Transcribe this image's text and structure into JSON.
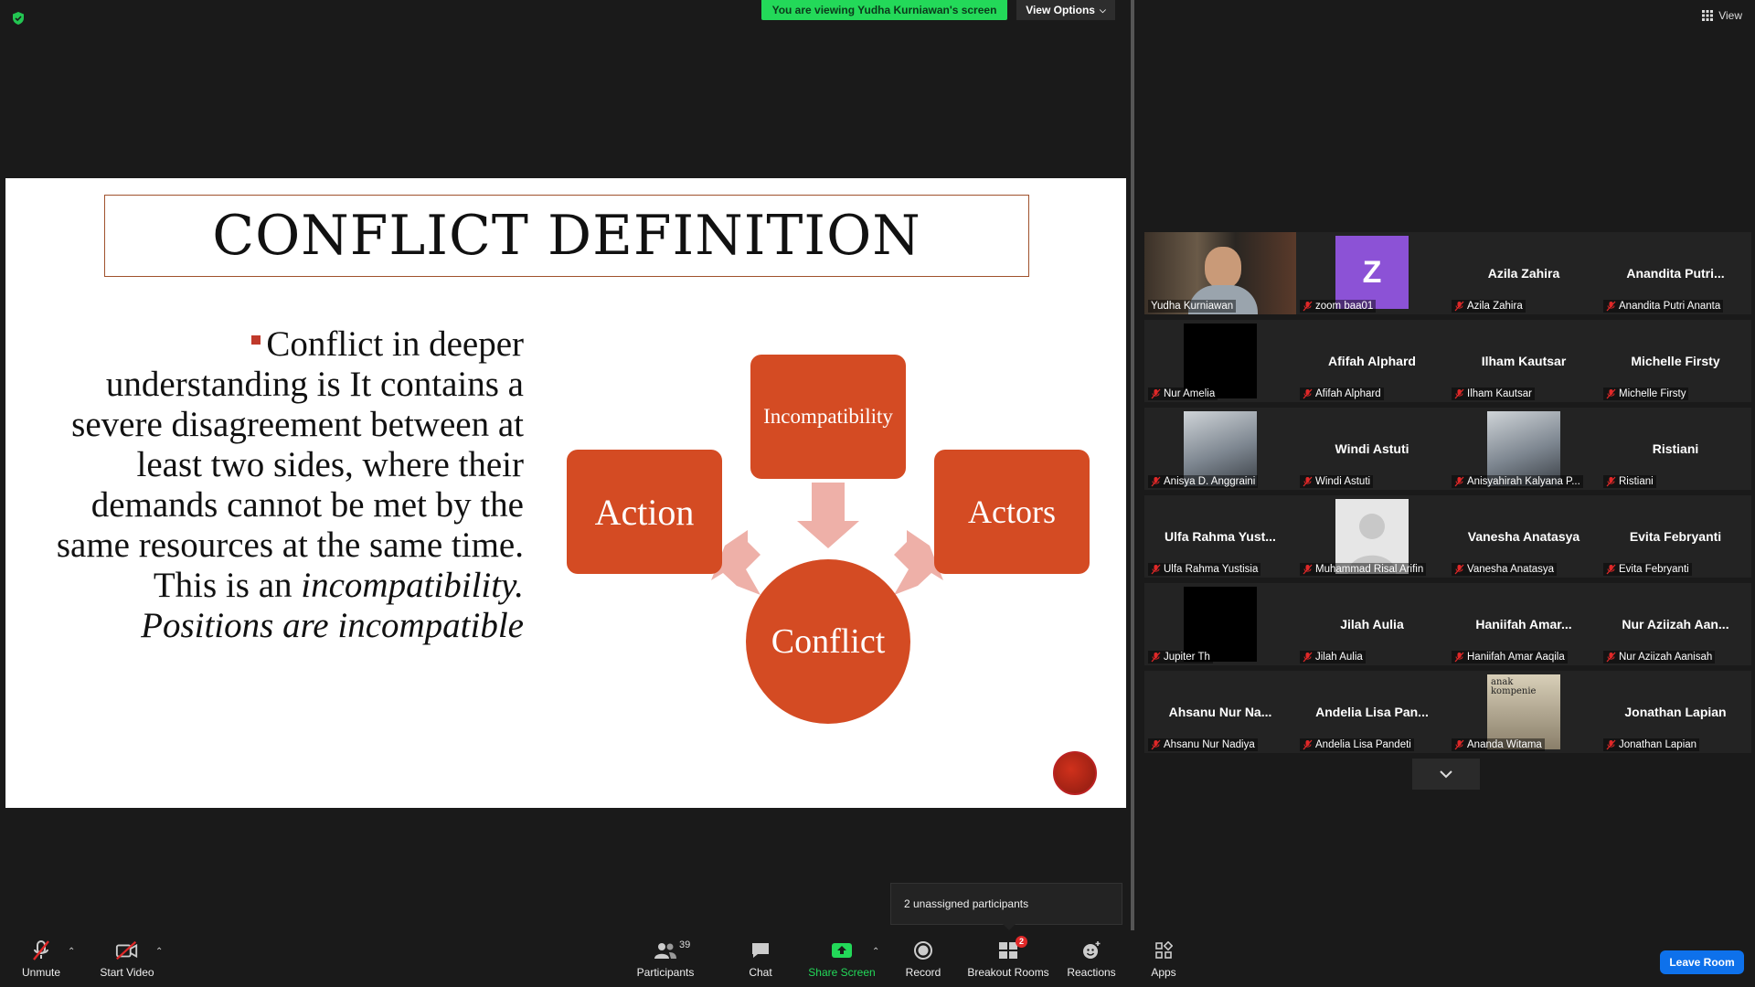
{
  "top": {
    "viewing_banner": "You are viewing Yudha Kurniawan's screen",
    "view_options": "View Options",
    "view_button": "View"
  },
  "slide": {
    "title": "CONFLICT DEFINITION",
    "body_plain": "Conflict in deeper understanding is It contains a severe disagreement between at least two sides, where their demands cannot be met by the same resources at the same time. This is an",
    "body_italic_1": "incompatibility.",
    "body_italic_2": "Positions are incompatible",
    "diagram": {
      "top_box": "Incompatibility",
      "left_box": "Action",
      "right_box": "Actors",
      "center": "Conflict"
    },
    "accent_color": "#d44b23"
  },
  "gallery": {
    "tiles": [
      {
        "name": "",
        "label": "Yudha Kurniawan",
        "type": "video",
        "active": true,
        "muted": false
      },
      {
        "name": "Z",
        "label": "zoom baa01",
        "type": "avatar",
        "muted": true
      },
      {
        "name": "Azila Zahira",
        "label": "Azila Zahira",
        "type": "name",
        "muted": true
      },
      {
        "name": "Anandita  Putri...",
        "label": "Anandita Putri Ananta",
        "type": "name",
        "muted": true
      },
      {
        "name": "",
        "label": "Nur Amelia",
        "type": "black",
        "muted": true
      },
      {
        "name": "Afifah Alphard",
        "label": "Afifah Alphard",
        "type": "name",
        "muted": true
      },
      {
        "name": "Ilham Kautsar",
        "label": "Ilham Kautsar",
        "type": "name",
        "muted": true
      },
      {
        "name": "Michelle Firsty",
        "label": "Michelle Firsty",
        "type": "name",
        "muted": true
      },
      {
        "name": "",
        "label": "Anisya D. Anggraini",
        "type": "photo",
        "muted": true
      },
      {
        "name": "Windi Astuti",
        "label": "Windi Astuti",
        "type": "name",
        "muted": true
      },
      {
        "name": "",
        "label": "Anisyahirah Kalyana P...",
        "type": "photo",
        "muted": true
      },
      {
        "name": "Ristiani",
        "label": "Ristiani",
        "type": "name",
        "muted": true
      },
      {
        "name": "Ulfa Rahma Yust...",
        "label": "Ulfa Rahma Yustisia",
        "type": "name",
        "muted": true
      },
      {
        "name": "",
        "label": "Muhammad Risal Arifin",
        "type": "placeholder",
        "muted": true
      },
      {
        "name": "Vanesha Anatasya",
        "label": "Vanesha Anatasya",
        "type": "name",
        "muted": true
      },
      {
        "name": "Evita Febryanti",
        "label": "Evita Febryanti",
        "type": "name",
        "muted": true
      },
      {
        "name": "",
        "label": "Jupiter Th",
        "type": "black",
        "muted": true
      },
      {
        "name": "Jilah Aulia",
        "label": "Jilah Aulia",
        "type": "name",
        "muted": true
      },
      {
        "name": "Haniifah  Amar...",
        "label": "Haniifah Amar Aaqila",
        "type": "name",
        "muted": true
      },
      {
        "name": "Nur  Aziizah  Aan...",
        "label": "Nur Aziizah Aanisah",
        "type": "name",
        "muted": true
      },
      {
        "name": "Ahsanu Nur Na...",
        "label": "Ahsanu Nur Nadiya",
        "type": "name",
        "muted": true
      },
      {
        "name": "Andelia Lisa Pan...",
        "label": "Andelia Lisa Pandeti",
        "type": "name",
        "muted": true
      },
      {
        "name": "",
        "label": "Ananda Witama",
        "type": "poster",
        "poster_text": "anak kompenie",
        "muted": true
      },
      {
        "name": "Jonathan Lapian",
        "label": "Jonathan Lapian",
        "type": "name",
        "muted": true
      }
    ]
  },
  "popup": {
    "unassigned": "2 unassigned participants"
  },
  "toolbar": {
    "unmute": "Unmute",
    "start_video": "Start Video",
    "participants": "Participants",
    "participants_count": "39",
    "chat": "Chat",
    "share_screen": "Share Screen",
    "record": "Record",
    "breakout_rooms": "Breakout Rooms",
    "breakout_badge": "2",
    "reactions": "Reactions",
    "apps": "Apps",
    "leave_room": "Leave Room"
  }
}
